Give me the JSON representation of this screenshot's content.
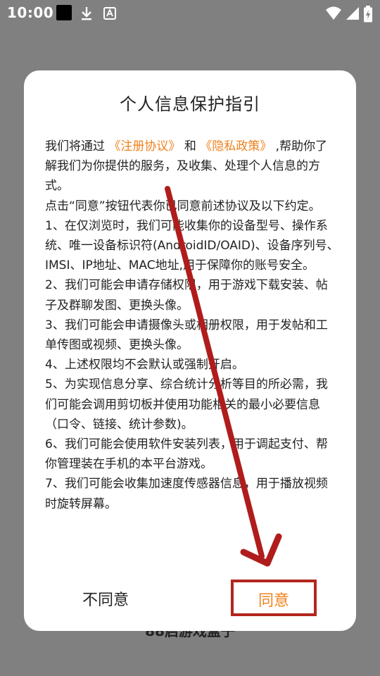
{
  "status_bar": {
    "time": "10:00",
    "icons": [
      "notification-square-icon",
      "download-icon",
      "a-badge-icon",
      "wifi-icon",
      "signal-icon",
      "battery-icon"
    ]
  },
  "background": {
    "app_title": "88启游戏盒子"
  },
  "dialog": {
    "title": "个人信息保护指引",
    "intro_prefix": "我们将通过",
    "link_register": "《注册协议》",
    "intro_and": "和",
    "link_privacy": "《隐私政策》",
    "intro_suffix": ",帮助你了解我们为你提供的服务，及收集、处理个人信息的方式。",
    "consent": "点击“同意”按钮代表你已同意前述协议及以下约定。",
    "items": [
      "1、在仅浏览时，我们可能收集你的设备型号、操作系统、唯一设备标识符(AndroidID/OAID)、设备序列号、IMSI、IP地址、MAC地址,用于保障你的账号安全。",
      "2、我们可能会申请存储权限，用于游戏下载安装、帖子及群聊发图、更换头像。",
      "3、我们可能会申请摄像头或相册权限，用于发帖和工单传图或视频、更换头像。",
      "4、上述权限均不会默认或强制开启。",
      "5、为实现信息分享、综合统计分析等目的所必需，我们可能会调用剪切板并使用功能相关的最小必要信息（口令、链接、统计参数)。",
      "6、我们可能会使用软件安装列表，用于调起支付、帮你管理装在手机的本平台游戏。",
      "7、我们可能会收集加速度传感器信息，用于播放视频时旋转屏幕。"
    ],
    "disagree_label": "不同意",
    "agree_label": "同意"
  },
  "colors": {
    "link": "#f0821e",
    "highlight_box": "#b3261e",
    "arrow": "#b01c1c",
    "scrim": "#808080"
  }
}
